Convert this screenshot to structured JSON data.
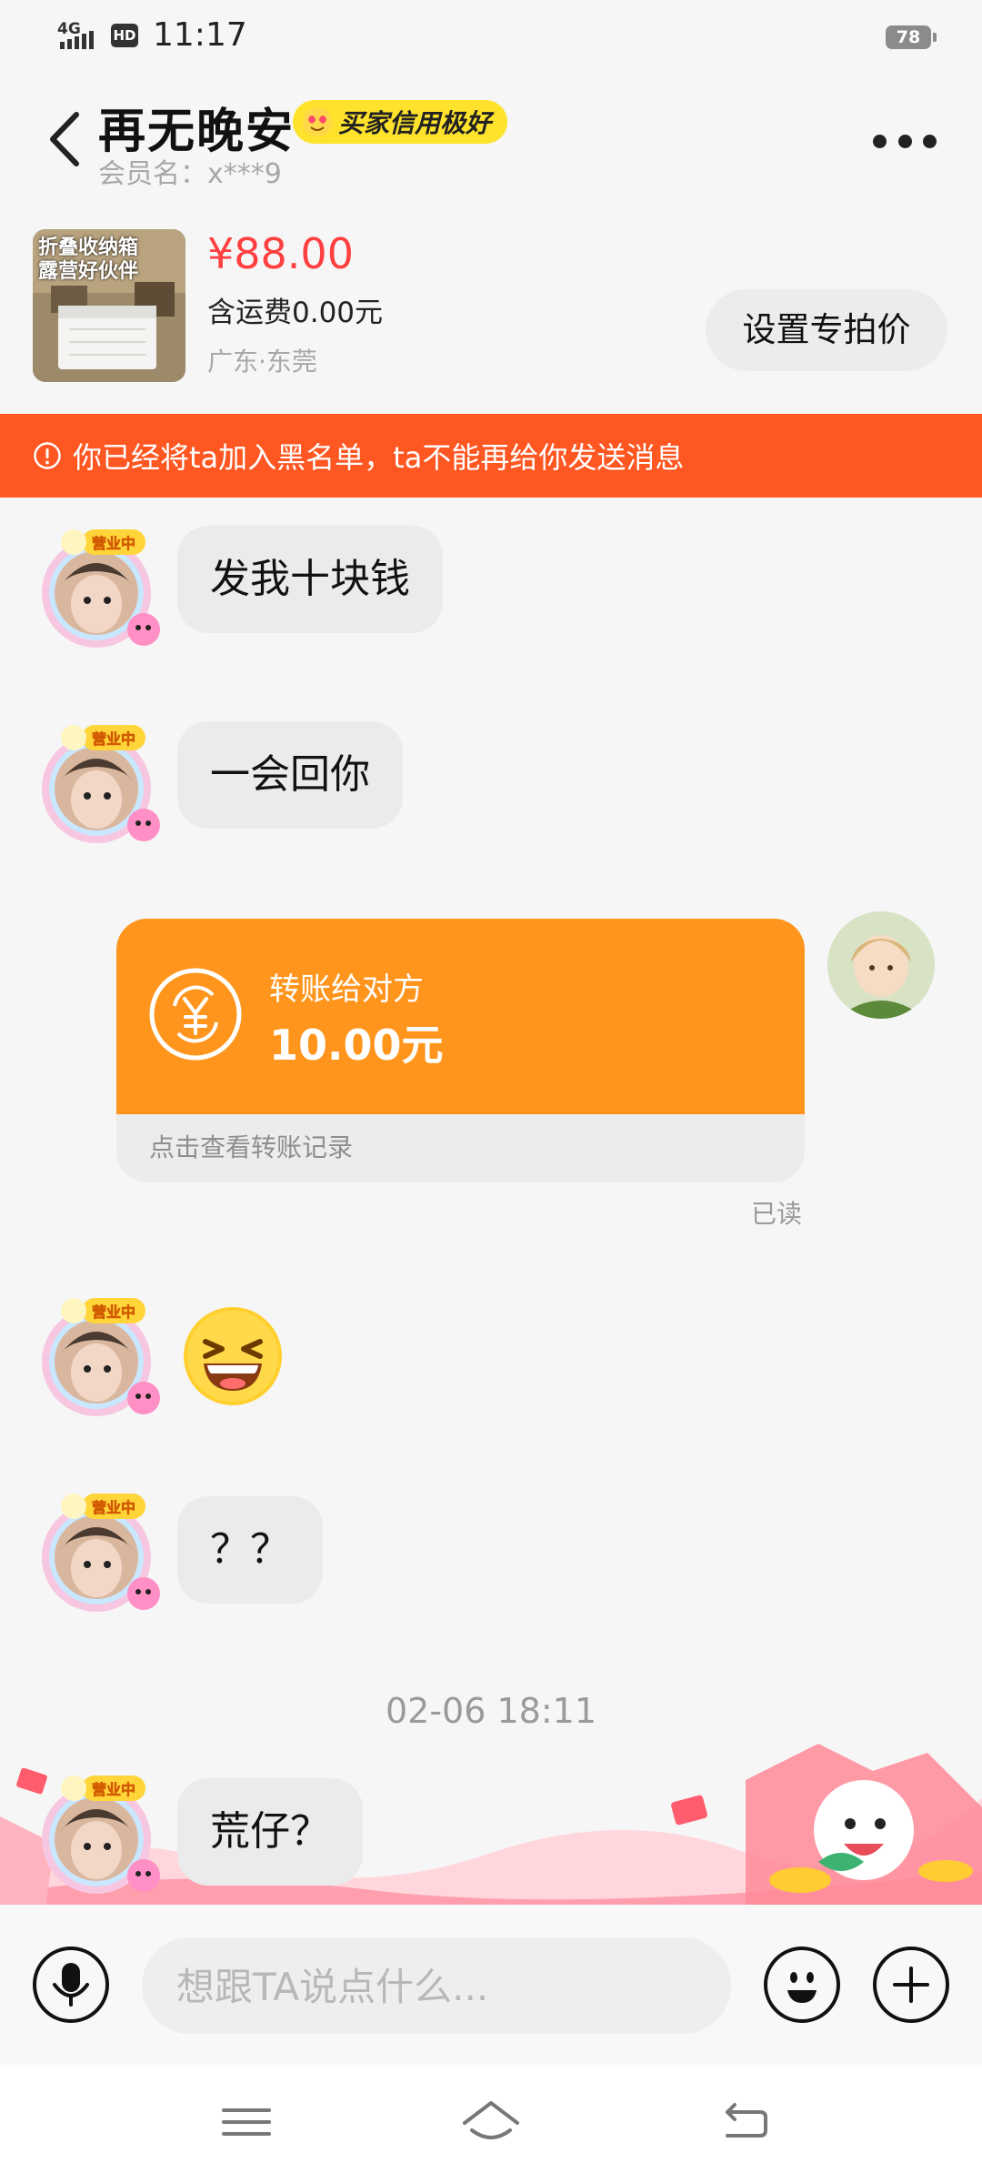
{
  "status_bar": {
    "network": "4G",
    "hd": "HD",
    "time": "11:17",
    "battery": "78"
  },
  "header": {
    "title": "再无晚安",
    "badge": "买家信用极好",
    "member": "会员名：x***9"
  },
  "product": {
    "thumb_text_line1": "折叠收纳箱",
    "thumb_text_line2": "露营好伙伴",
    "price": "¥88.00",
    "shipping": "含运费0.00元",
    "location": "广东·东莞",
    "set_price_label": "设置专拍价"
  },
  "banner": {
    "text": "你已经将ta加入黑名单，ta不能再给你发送消息"
  },
  "avatar_badge": "营业中",
  "messages": {
    "m1": "发我十块钱",
    "m2": "一会回你",
    "transfer": {
      "label": "转账给对方",
      "amount": "10.00元",
      "link": "点击查看转账记录",
      "read": "已读"
    },
    "m4": "？？",
    "timestamp": "02-06 18:11",
    "m5": "荒仔？"
  },
  "input": {
    "placeholder": "想跟TA说点什么..."
  },
  "colors": {
    "accent_orange": "#ff951c",
    "banner_red": "#ff5722",
    "price_red": "#ff4040",
    "badge_yellow": "#ffe22b"
  }
}
